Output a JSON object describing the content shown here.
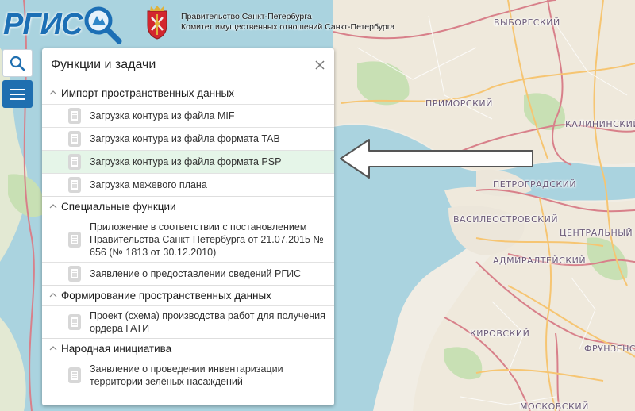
{
  "header": {
    "logo_text": "РГИС",
    "gov_line1": "Правительство Санкт-Петербурга",
    "gov_line2": "Комитет имущественных отношений Санкт-Петербурга"
  },
  "map": {
    "districts": [
      "Выборгский",
      "Приморский",
      "Калининский",
      "Петроградский",
      "Василеостровский",
      "Центральный",
      "Адмиралтейский",
      "Кировский",
      "Фрунзенский",
      "Московский"
    ]
  },
  "panel": {
    "title": "Функции и задачи",
    "sections": [
      {
        "title": "Импорт пространственных данных",
        "items": [
          "Загрузка контура из файла MIF",
          "Загрузка контура из файла формата TAB",
          "Загрузка контура из файла формата PSP",
          "Загрузка межевого плана"
        ]
      },
      {
        "title": "Специальные функции",
        "items": [
          "Приложение в соответствии с постановлением Правительства Санкт-Петербурга от 21.07.2015 № 656 (№ 1813 от 30.12.2010)",
          "Заявление о предоставлении сведений РГИС"
        ]
      },
      {
        "title": "Формирование пространственных данных",
        "items": [
          "Проект (схема) производства работ для получения ордера ГАТИ"
        ]
      },
      {
        "title": "Народная инициатива",
        "items": [
          "Заявление о проведении инвентаризации территории зелёных насаждений"
        ]
      }
    ],
    "highlighted_item": "Загрузка контура из файла формата PSP"
  },
  "colors": {
    "accent_blue": "#1f6fb0",
    "highlight_green": "#e5f5e8",
    "water": "#aad3df"
  },
  "icons": {
    "search": "search-icon",
    "menu": "menu-icon",
    "close": "close-icon",
    "document": "document-icon",
    "chevron": "chevron-up-icon",
    "arrow": "arrow-left-icon"
  }
}
